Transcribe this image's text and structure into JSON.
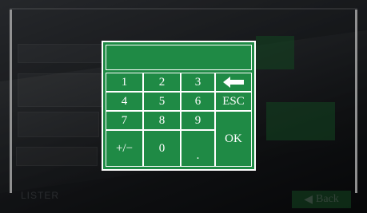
{
  "background": {
    "labels": [
      "",
      "",
      "",
      ""
    ],
    "bottom_label": "LISTER",
    "back_label": "Back"
  },
  "keypad": {
    "display_value": "",
    "keys": {
      "k1": "1",
      "k2": "2",
      "k3": "3",
      "backspace": "backspace-arrow",
      "k4": "4",
      "k5": "5",
      "k6": "6",
      "esc": "ESC",
      "k7": "7",
      "k8": "8",
      "k9": "9",
      "ok": "OK",
      "plusminus": "+/−",
      "k0": "0",
      "dot": "."
    },
    "colors": {
      "key_green": "#1f8a45",
      "border": "#ffffff"
    }
  }
}
